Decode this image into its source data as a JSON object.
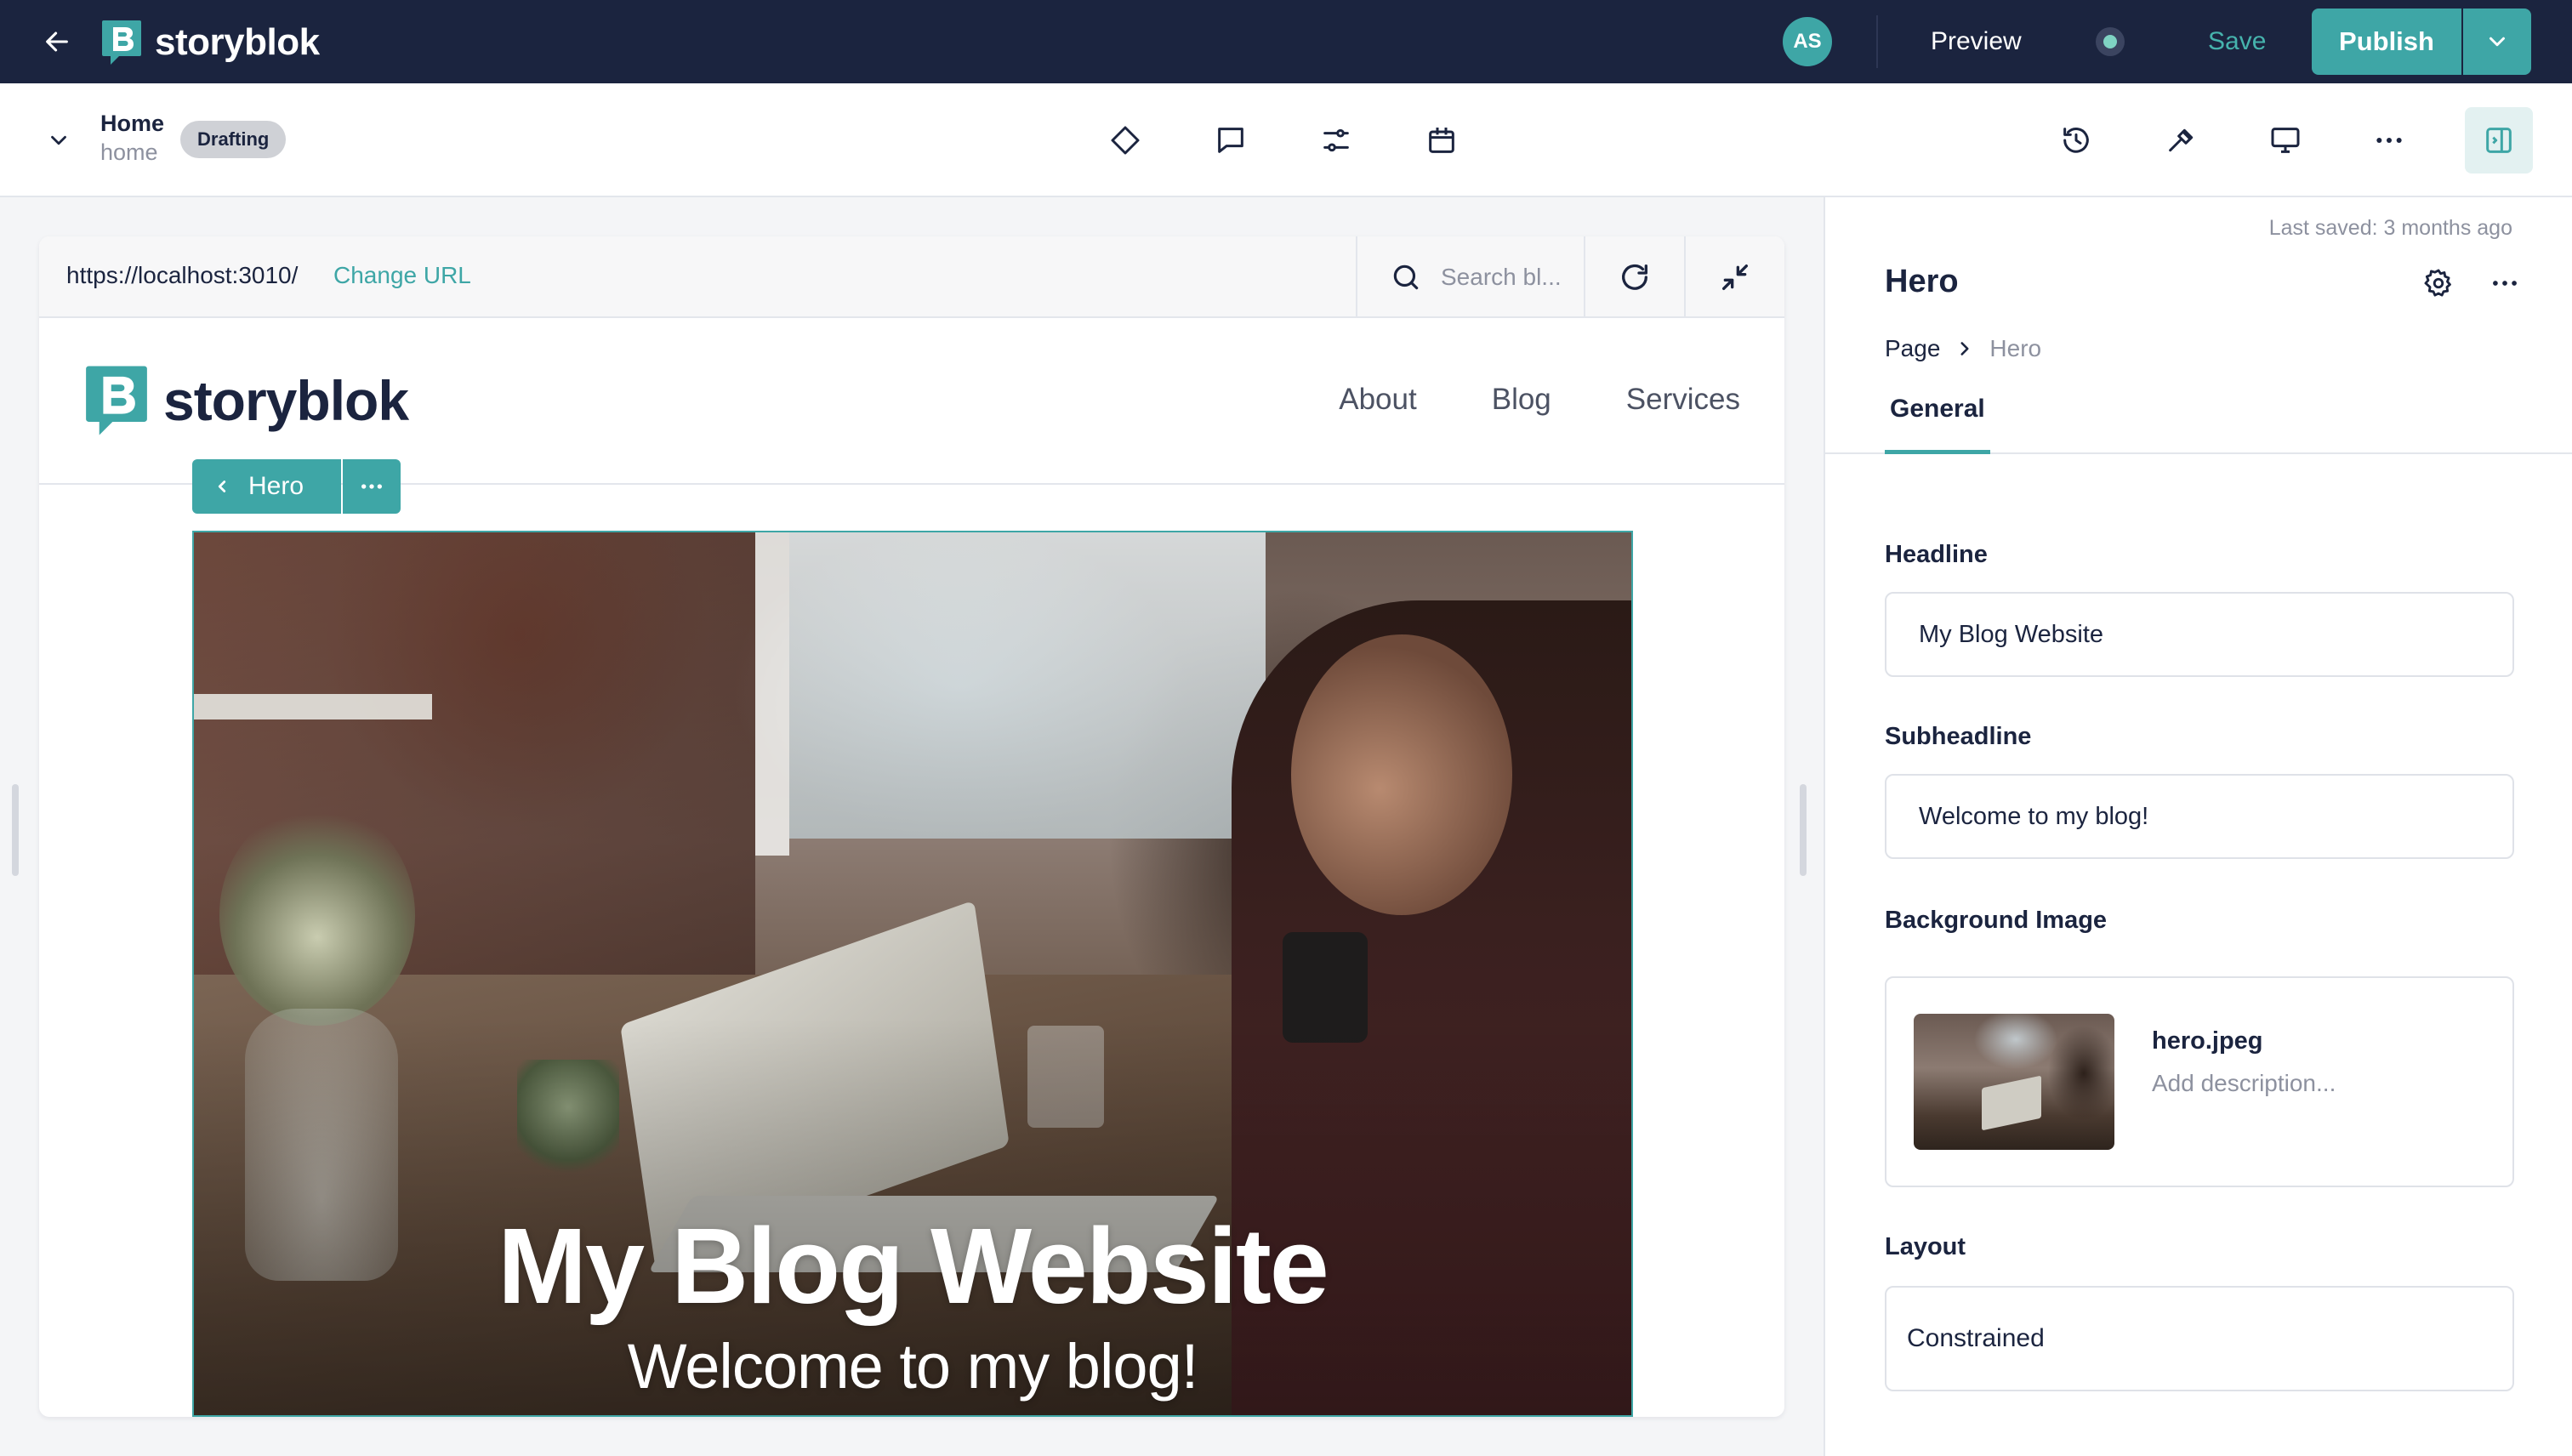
{
  "topbar": {
    "logo_text": "storyblok",
    "avatar_initials": "AS",
    "preview_label": "Preview",
    "save_label": "Save",
    "publish_label": "Publish"
  },
  "story": {
    "title": "Home",
    "slug": "home",
    "status": "Drafting"
  },
  "preview": {
    "url": "https://localhost:3010/",
    "change_url_label": "Change URL",
    "search_placeholder": "Search bl...",
    "site_logo_text": "storyblok",
    "nav": [
      "About",
      "Blog",
      "Services"
    ],
    "block_label": "Hero",
    "hero_headline": "My Blog Website",
    "hero_subheadline": "Welcome to my blog!"
  },
  "panel": {
    "last_saved": "Last saved: 3 months ago",
    "title": "Hero",
    "breadcrumb_page": "Page",
    "breadcrumb_current": "Hero",
    "tab_general": "General",
    "fields": {
      "headline_label": "Headline",
      "headline_value": "My Blog Website",
      "subheadline_label": "Subheadline",
      "subheadline_value": "Welcome to my blog!",
      "background_label": "Background Image",
      "asset_name": "hero.jpeg",
      "asset_description_placeholder": "Add description...",
      "layout_label": "Layout",
      "layout_value": "Constrained"
    }
  },
  "colors": {
    "topbar_bg": "#1b243f",
    "accent": "#3ea6a6"
  }
}
